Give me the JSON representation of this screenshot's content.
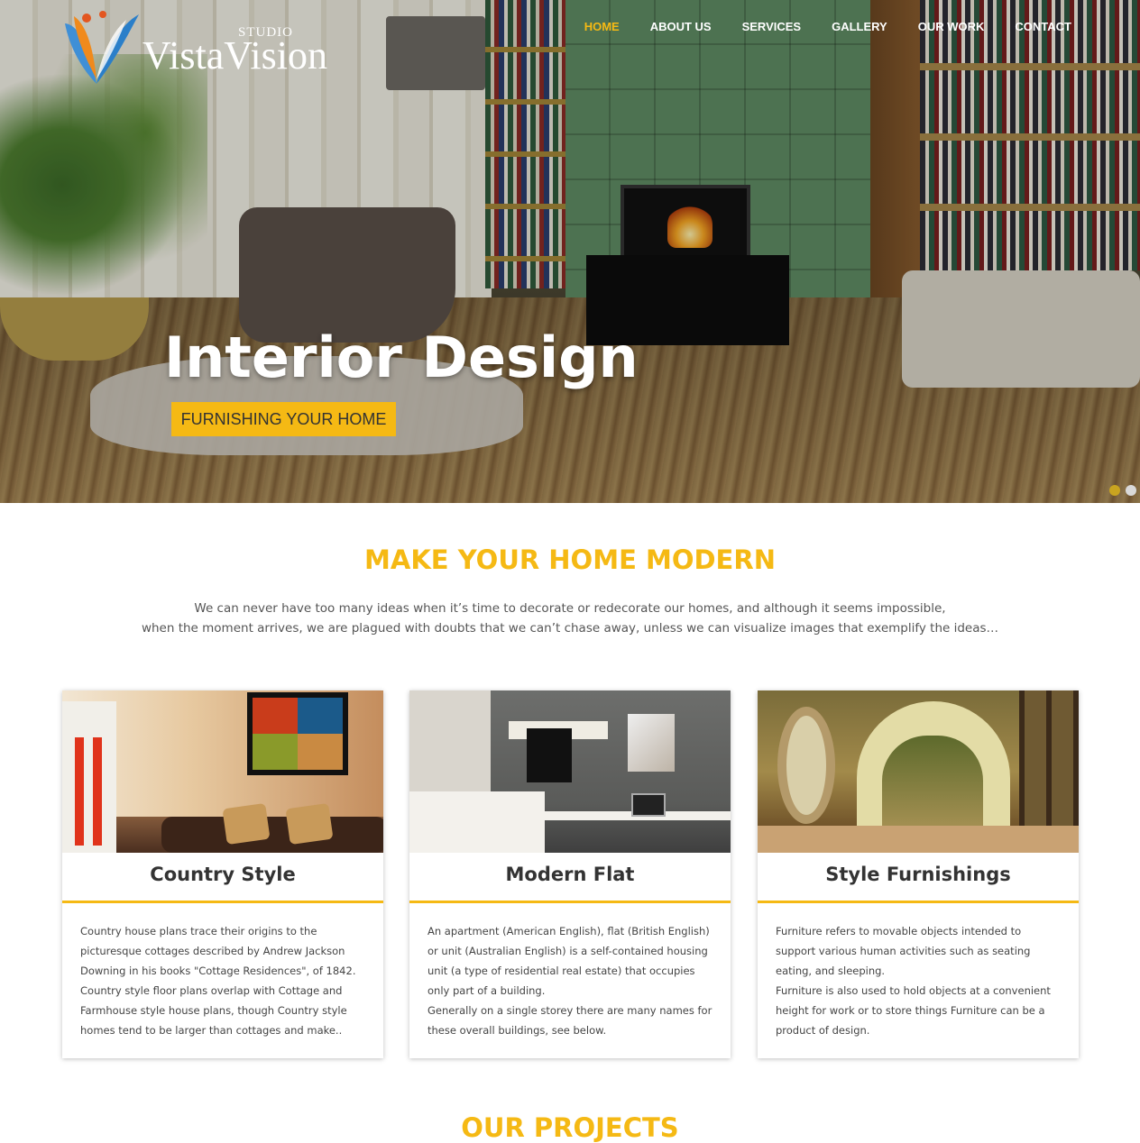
{
  "brand": {
    "logo_studio": "STUDIO",
    "logo_name": "VistaVision"
  },
  "nav": {
    "items": [
      {
        "label": "HOME",
        "active": true
      },
      {
        "label": "ABOUT US",
        "active": false
      },
      {
        "label": "SERVICES",
        "active": false
      },
      {
        "label": "GALLERY",
        "active": false
      },
      {
        "label": "OUR WORK",
        "active": false
      },
      {
        "label": "CONTACT",
        "active": false
      }
    ]
  },
  "hero": {
    "title": "Interior Design",
    "button_label": "FURNISHING YOUR HOME",
    "slides": [
      {
        "active": true
      },
      {
        "active": false
      }
    ]
  },
  "intro": {
    "title": "MAKE YOUR HOME MODERN",
    "line1": "We can never have too many ideas when it’s time to decorate or redecorate our homes, and although it seems impossible,",
    "line2": "when the moment arrives, we are plagued with doubts that we can’t chase away, unless we can visualize images that exemplify the ideas…"
  },
  "cards": [
    {
      "title": "Country Style",
      "text": "Country house plans trace their origins to the picturesque cottages described by Andrew Jackson Downing in his books \"Cottage Residences\", of 1842. Country style floor plans overlap with Cottage and Farmhouse style house plans, though Country style homes tend to be larger than cottages and make.."
    },
    {
      "title": "Modern Flat",
      "text": "An apartment (American English), flat (British English) or unit (Australian English) is a self-contained housing unit (a type of residential real estate) that occupies only part of a building.\nGenerally on a single storey there are many names for these overall buildings, see below."
    },
    {
      "title": "Style Furnishings",
      "text": "Furniture refers to movable objects intended to support various human activities such as seating eating, and sleeping.\nFurniture is also used to hold objects at a convenient height for work or to store things Furniture can be a product of design."
    }
  ],
  "next_section": {
    "title": "OUR PROJECTS"
  },
  "colors": {
    "accent": "#f5b914",
    "text": "#333333"
  }
}
